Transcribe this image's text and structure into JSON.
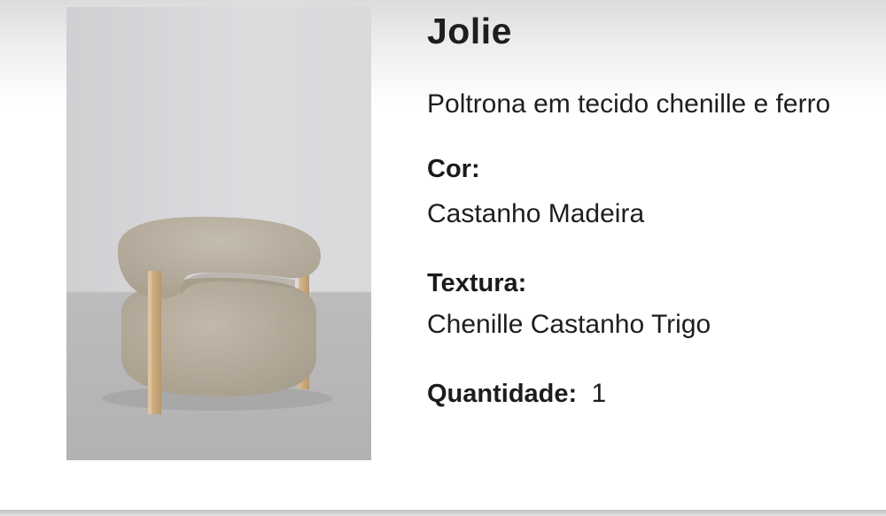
{
  "product": {
    "name": "Jolie",
    "description": "Poltrona em tecido chenille e ferro",
    "color_label": "Cor:",
    "color_value": "Castanho Madeira",
    "texture_label": "Textura:",
    "texture_value": "Chenille Castanho Trigo",
    "quantity_label": "Quantidade:",
    "quantity_value": "1"
  },
  "image": {
    "icon": "armchair-photo",
    "colors": {
      "wall": "#d6d6d9",
      "floor": "#b8b6b6",
      "fabric": "#b5ab9c",
      "wood": "#c9a97c"
    }
  }
}
